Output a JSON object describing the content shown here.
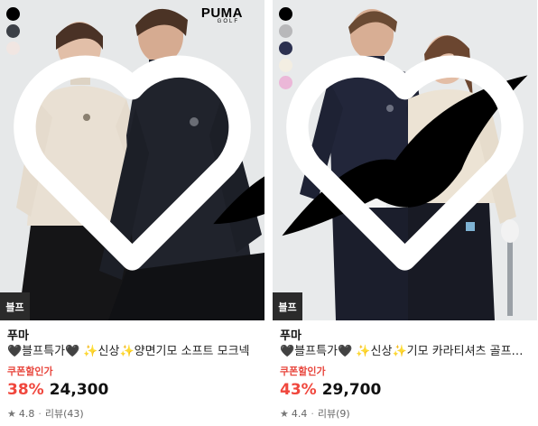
{
  "products": [
    {
      "brand_logo": {
        "word": "PUMA",
        "sub": "GOLF"
      },
      "swatches": [
        "#000000",
        "#3c4047",
        "#f1e6e2"
      ],
      "badge": "블프",
      "brand_name": "푸마",
      "title": "🖤블프특가🖤 ✨신상✨양면기모 소프트 모크넥",
      "coupon_label": "쿠폰할인가",
      "discount": "38%",
      "price": "24,300",
      "rating": "4.8",
      "reviews": "리뷰(43)",
      "heart_icon": "heart-outline-icon"
    },
    {
      "brand_logo": {
        "word": "",
        "sub": ""
      },
      "swatches": [
        "#000000",
        "#b8b8ba",
        "#2c3150",
        "#f3eee2",
        "#ebb7d8"
      ],
      "badge": "블프",
      "brand_name": "푸마",
      "title": "🖤블프특가🖤 ✨신상✨기모 카라티셔츠 골프웨어",
      "coupon_label": "쿠폰할인가",
      "discount": "43%",
      "price": "29,700",
      "rating": "4.4",
      "reviews": "리뷰(9)",
      "heart_icon": "heart-outline-icon"
    }
  ]
}
